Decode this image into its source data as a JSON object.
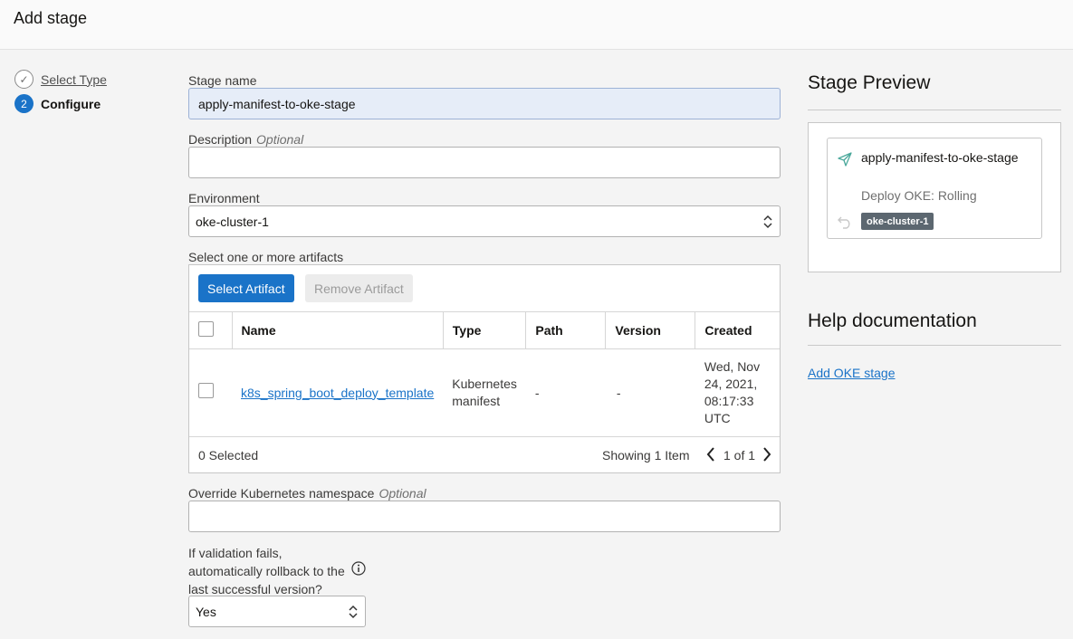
{
  "header": {
    "title": "Add stage"
  },
  "steps": [
    {
      "number": "✓",
      "label": "Select Type"
    },
    {
      "number": "2",
      "label": "Configure"
    }
  ],
  "form": {
    "stage_name": {
      "label": "Stage name",
      "value": "apply-manifest-to-oke-stage"
    },
    "description": {
      "label": "Description",
      "optional": "Optional",
      "value": ""
    },
    "environment": {
      "label": "Environment",
      "value": "oke-cluster-1"
    },
    "artifacts": {
      "label": "Select one or more artifacts",
      "select_button": "Select Artifact",
      "remove_button": "Remove Artifact",
      "columns": [
        "Name",
        "Type",
        "Path",
        "Version",
        "Created"
      ],
      "rows": [
        {
          "name": "k8s_spring_boot_deploy_template",
          "type": "Kubernetes manifest",
          "path": "-",
          "version": "-",
          "created": "Wed, Nov 24, 2021, 08:17:33 UTC"
        }
      ],
      "selected": "0 Selected",
      "showing": "Showing 1 Item",
      "page": "1 of 1"
    },
    "namespace": {
      "label": "Override Kubernetes namespace",
      "optional": "Optional",
      "value": ""
    },
    "rollback": {
      "label": "If validation fails, automatically rollback to the last successful version?",
      "value": "Yes"
    }
  },
  "preview": {
    "title": "Stage Preview",
    "stage_name": "apply-manifest-to-oke-stage",
    "stage_type": "Deploy OKE: Rolling",
    "environment_badge": "oke-cluster-1"
  },
  "help": {
    "title": "Help documentation",
    "link": "Add OKE stage"
  },
  "colors": {
    "accent": "#1a73c8",
    "badge": "#5c6770",
    "preview_icon": "#4aa89b"
  }
}
